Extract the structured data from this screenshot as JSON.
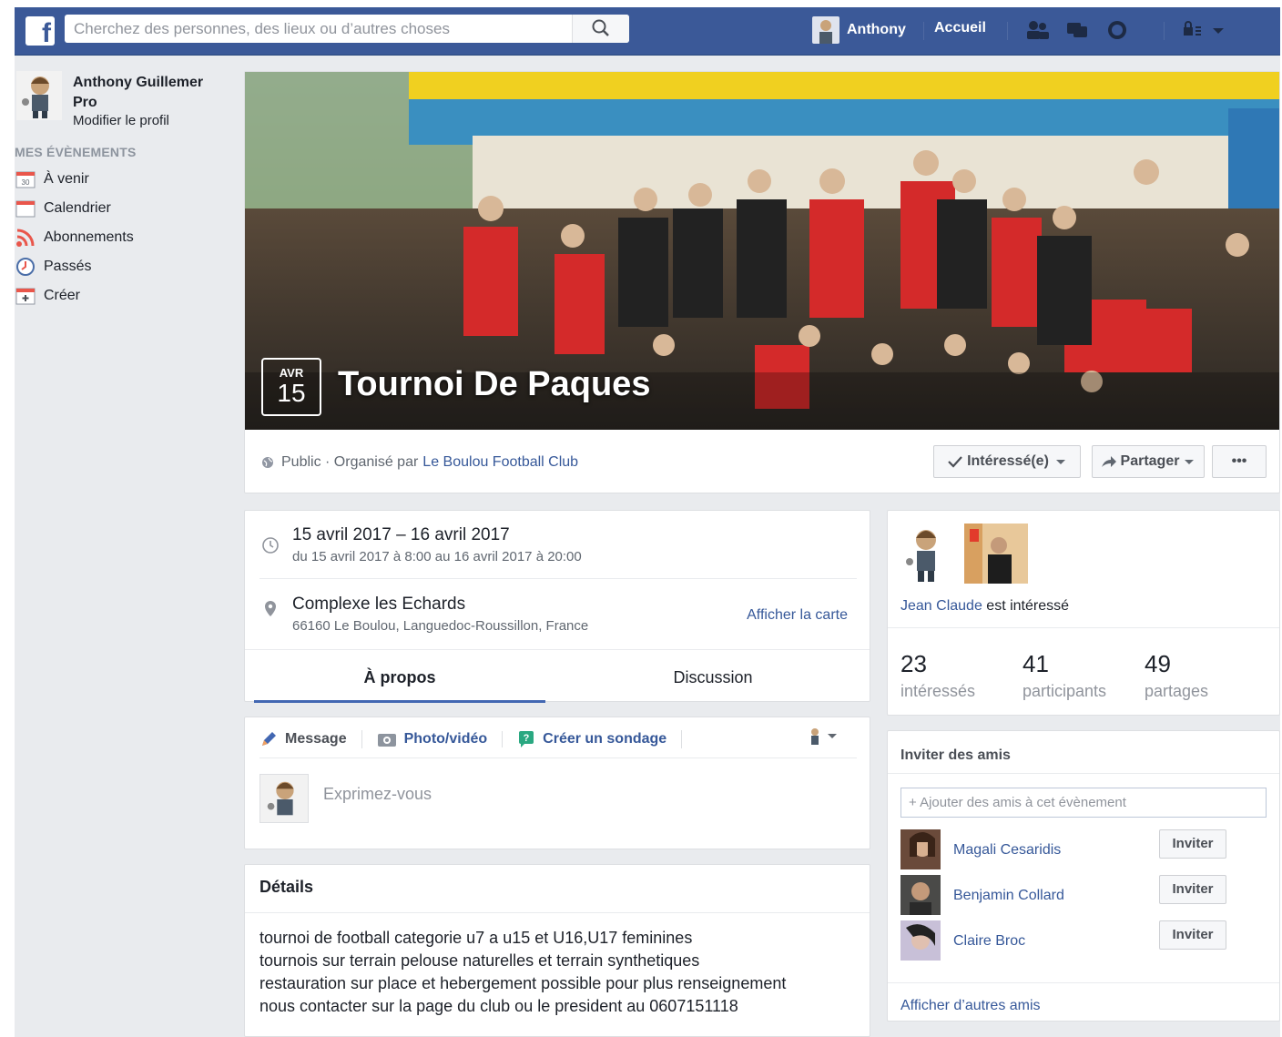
{
  "topbar": {
    "search_placeholder": "Cherchez des personnes, des lieux ou d’autres choses",
    "user_name": "Anthony",
    "home_label": "Accueil"
  },
  "sidebar": {
    "profile_name": "Anthony Guillemer Pro",
    "edit_profile": "Modifier le profil",
    "section_title": "MES ÉVÈNEMENTS",
    "items": [
      {
        "label": "À venir",
        "icon": "calendar-30-icon"
      },
      {
        "label": "Calendrier",
        "icon": "calendar-icon"
      },
      {
        "label": "Abonnements",
        "icon": "rss-icon"
      },
      {
        "label": "Passés",
        "icon": "clock-icon"
      },
      {
        "label": "Créer",
        "icon": "plus-icon"
      }
    ]
  },
  "event": {
    "month": "AVR",
    "day": "15",
    "title": "Tournoi De Paques",
    "privacy": "Public · Organisé par",
    "organizer": "Le Boulou Football Club",
    "interested_btn": "Intéressé(e)",
    "share_btn": "Partager",
    "more_btn": "•••",
    "date_main": "15 avril 2017 – 16 avril 2017",
    "date_sub": "du 15 avril 2017 à 8:00 au 16 avril 2017 à 20:00",
    "place_main": "Complexe les Echards",
    "place_sub": "66160 Le Boulou, Languedoc-Roussillon, France",
    "map_link": "Afficher la carte",
    "tabs": [
      "À propos",
      "Discussion"
    ]
  },
  "composer": {
    "tabs": [
      "Message",
      "Photo/vidéo",
      "Créer un sondage"
    ],
    "placeholder": "Exprimez-vous"
  },
  "details": {
    "title": "Détails",
    "lines": [
      "tournoi de football categorie u7 a u15 et U16,U17 feminines",
      "tournois sur terrain pelouse naturelles et terrain synthetiques",
      "restauration sur place et hebergement possible pour plus renseignement",
      "nous contacter sur la page du club ou le president au 0607151118"
    ]
  },
  "guests": {
    "name": "Jean Claude",
    "suffix": "est intéressé",
    "stats": [
      {
        "num": "23",
        "label": "intéressés"
      },
      {
        "num": "41",
        "label": "participants"
      },
      {
        "num": "49",
        "label": "partages"
      }
    ]
  },
  "invite": {
    "title": "Inviter des amis",
    "placeholder": "+ Ajouter des amis à cet évènement",
    "friends": [
      {
        "name": "Magali Cesaridis",
        "btn": "Inviter"
      },
      {
        "name": "Benjamin Collard",
        "btn": "Inviter"
      },
      {
        "name": "Claire Broc",
        "btn": "Inviter"
      }
    ],
    "more": "Afficher d’autres amis"
  },
  "colors": {
    "brand": "#3b5998",
    "link": "#365899",
    "accent": "#4267b2"
  }
}
